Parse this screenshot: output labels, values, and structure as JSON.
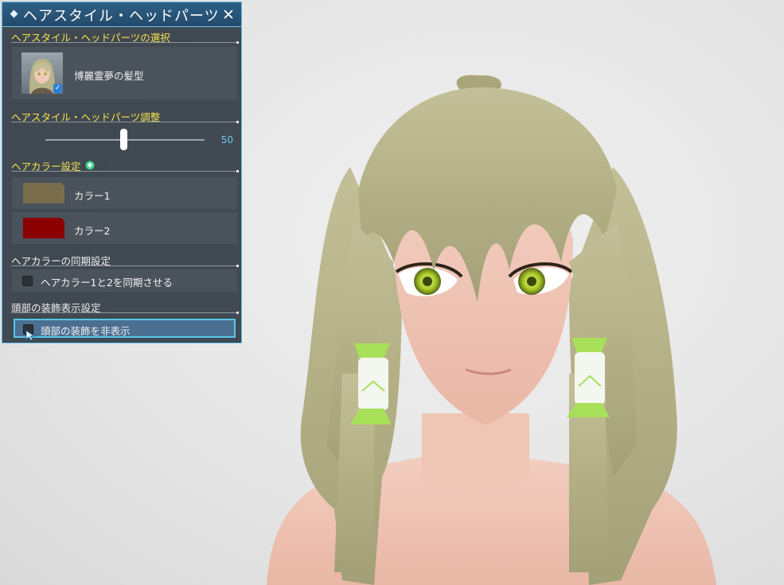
{
  "window": {
    "title": "ヘアスタイル・ヘッドパーツ",
    "close_icon": "close-icon"
  },
  "sections": {
    "select": {
      "heading": "ヘアスタイル・ヘッドパーツの選択",
      "selected_item": "博麗霊夢の髪型"
    },
    "adjust": {
      "heading": "ヘアスタイル・ヘッドパーツ調整",
      "value": "50",
      "slider_fraction": 0.5
    },
    "hair_color": {
      "heading": "ヘアカラー設定",
      "badge_icon": "gem-icon",
      "colors": [
        {
          "label": "カラー1",
          "swatch": "#7a6d4c"
        },
        {
          "label": "カラー2",
          "swatch": "#8b0000"
        }
      ]
    },
    "sync": {
      "heading": "ヘアカラーの同期設定",
      "option": "ヘアカラー1と2を同期させる",
      "checked": false
    },
    "head_accessory": {
      "heading": "頭部の装飾表示設定",
      "option": "頭部の装飾を非表示",
      "checked": false
    }
  },
  "colors": {
    "heading_yellow": "#f5e34a",
    "value_blue": "#6fc7ef",
    "selection_border": "#56c6e8",
    "hair": "#b9b48a",
    "eye": "#b8d234",
    "hair_tie_green": "#a8e05a"
  }
}
